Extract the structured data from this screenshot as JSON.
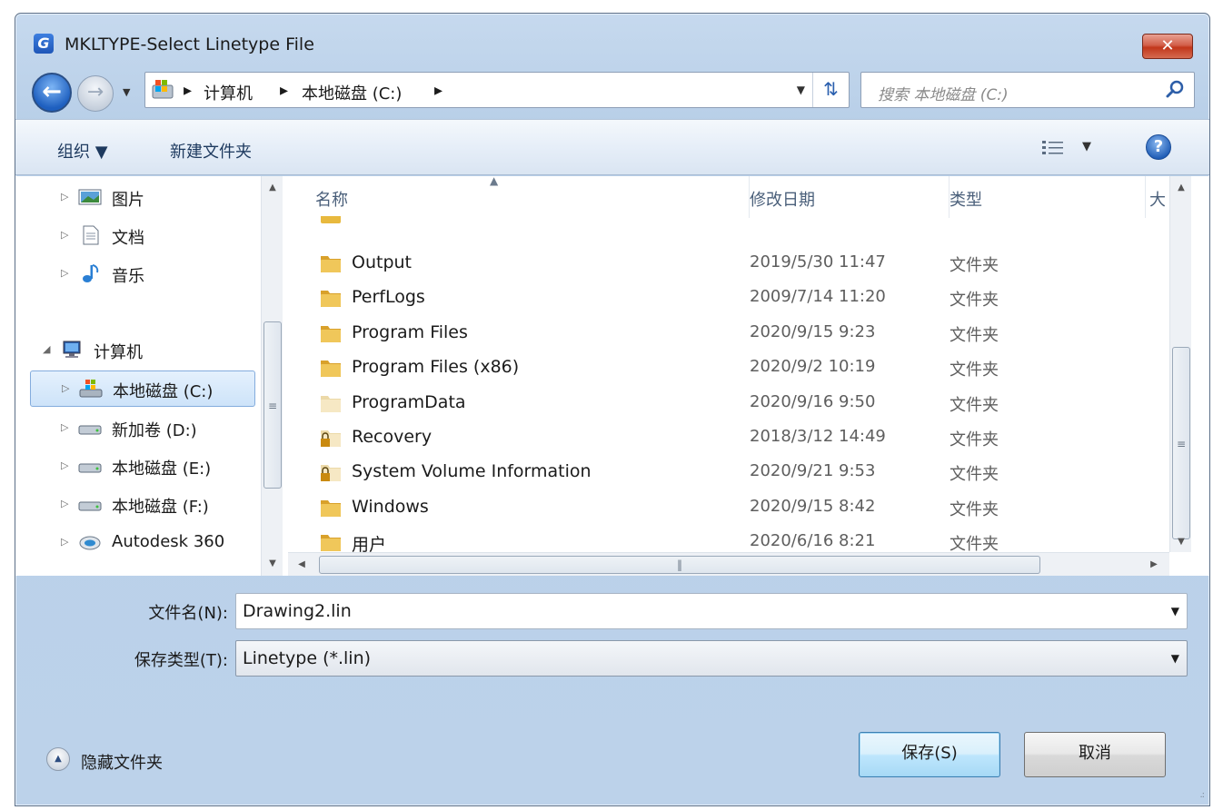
{
  "window": {
    "app_icon_letter": "G",
    "title": "MKLTYPE-Select Linetype File",
    "close_label": "✕"
  },
  "nav": {
    "breadcrumbs": [
      "计算机",
      "本地磁盘 (C:)"
    ],
    "search_placeholder": "搜索 本地磁盘 (C:)"
  },
  "toolbar": {
    "organize_label": "组织 ▼",
    "new_folder_label": "新建文件夹",
    "help_label": "?"
  },
  "sidebar": {
    "items": [
      {
        "label": "图片",
        "icon": "pictures-icon"
      },
      {
        "label": "文档",
        "icon": "documents-icon"
      },
      {
        "label": "音乐",
        "icon": "music-icon"
      },
      {
        "label": "计算机",
        "icon": "computer-icon"
      },
      {
        "label": "本地磁盘 (C:)",
        "icon": "system-drive-icon",
        "selected": true
      },
      {
        "label": "新加卷 (D:)",
        "icon": "drive-icon"
      },
      {
        "label": "本地磁盘 (E:)",
        "icon": "drive-icon"
      },
      {
        "label": "本地磁盘 (F:)",
        "icon": "drive-icon"
      },
      {
        "label": "Autodesk 360",
        "icon": "cloud-icon"
      }
    ]
  },
  "files": {
    "columns": [
      "名称",
      "修改日期",
      "类型",
      "大"
    ],
    "rows": [
      {
        "name": "Output",
        "date": "2019/5/30 11:47",
        "type": "文件夹",
        "icon": "folder"
      },
      {
        "name": "PerfLogs",
        "date": "2009/7/14 11:20",
        "type": "文件夹",
        "icon": "folder"
      },
      {
        "name": "Program Files",
        "date": "2020/9/15 9:23",
        "type": "文件夹",
        "icon": "folder"
      },
      {
        "name": "Program Files (x86)",
        "date": "2020/9/2 10:19",
        "type": "文件夹",
        "icon": "folder"
      },
      {
        "name": "ProgramData",
        "date": "2020/9/16 9:50",
        "type": "文件夹",
        "icon": "folder-hidden"
      },
      {
        "name": "Recovery",
        "date": "2018/3/12 14:49",
        "type": "文件夹",
        "icon": "folder-locked"
      },
      {
        "name": "System Volume Information",
        "date": "2020/9/21 9:53",
        "type": "文件夹",
        "icon": "folder-locked"
      },
      {
        "name": "Windows",
        "date": "2020/9/15 8:42",
        "type": "文件夹",
        "icon": "folder"
      },
      {
        "name": "用户",
        "date": "2020/6/16 8:21",
        "type": "文件夹",
        "icon": "folder"
      }
    ]
  },
  "form": {
    "filename_label": "文件名(N):",
    "filename_value": "Drawing2.lin",
    "filetype_label": "保存类型(T):",
    "filetype_value": "Linetype (*.lin)"
  },
  "footer": {
    "hide_folders_label": "隐藏文件夹",
    "save_label": "保存(S)",
    "cancel_label": "取消"
  },
  "colors": {
    "frame": "#b8cfe8",
    "folder": "#e8b93e",
    "selection": "#cde3f9",
    "close": "#c1371b"
  }
}
